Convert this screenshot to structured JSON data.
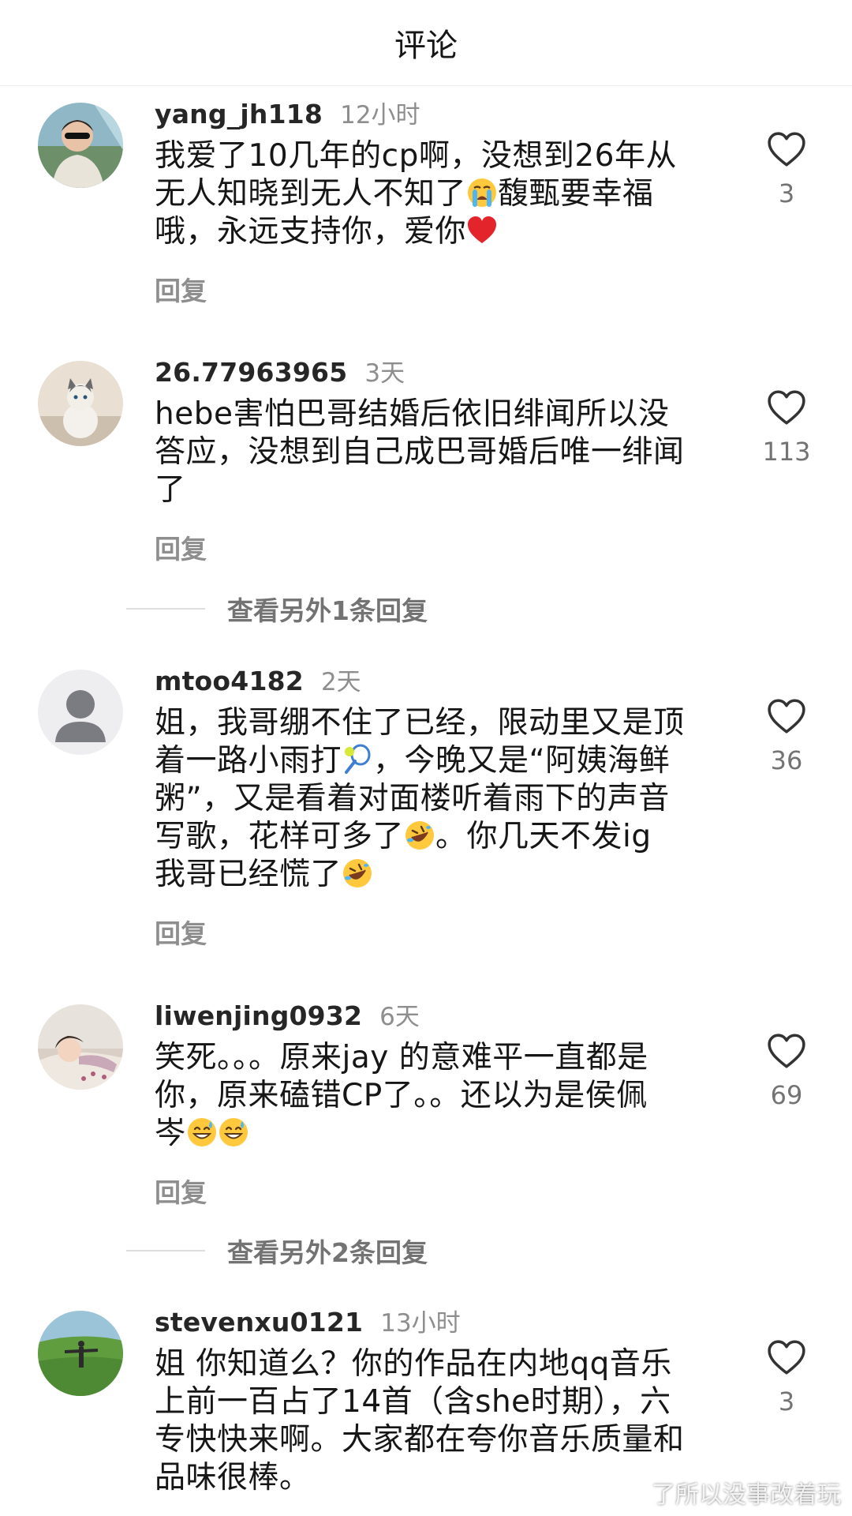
{
  "header": {
    "title": "评论"
  },
  "comments": [
    {
      "username": "yang_jh118",
      "time": "12小时",
      "text_parts": [
        "我爱了10几年的cp啊，没想到26年从\n无人知晓到无人不知了",
        "馥甄要幸福\n哦，永远支持你，爱你",
        ""
      ],
      "reply_label": "回复",
      "likes": "3"
    },
    {
      "username": "26.77963965",
      "time": "3天",
      "text_parts": [
        "hebe害怕巴哥结婚后依旧绯闻所以没\n答应，没想到自己成巴哥婚后唯一绯闻\n了"
      ],
      "reply_label": "回复",
      "likes": "113",
      "more_replies": "查看另外1条回复"
    },
    {
      "username": "mtoo4182",
      "time": "2天",
      "text_parts": [
        "姐，我哥绷不住了已经，限动里又是顶\n着一路小雨打",
        "，今晚又是“阿姨海鲜\n粥”，又是看着对面楼听着雨下的声音\n写歌，花样可多了",
        "。你几天不发ig\n我哥已经慌了",
        ""
      ],
      "reply_label": "回复",
      "likes": "36"
    },
    {
      "username": "liwenjing0932",
      "time": "6天",
      "text_parts": [
        "笑死。。。原来jay 的意难平一直都是\n你，原来磕错CP了。。还以为是侯佩\n岑",
        "",
        ""
      ],
      "reply_label": "回复",
      "likes": "69",
      "more_replies": "查看另外2条回复"
    },
    {
      "username": "stevenxu0121",
      "time": "13小时",
      "text_parts": [
        "姐  你知道么？你的作品在内地qq音乐\n上前一百占了14首（含she时期），六\n专快快来啊。大家都在夸你音乐质量和\n品味很棒。"
      ],
      "likes": "3"
    }
  ],
  "watermark": "了所以没事改着玩",
  "icons": {
    "like": "heart-outline-icon",
    "emoji_cry": "loudly-crying-face-emoji",
    "emoji_heart": "red-heart-emoji",
    "emoji_tennis": "tennis-emoji",
    "emoji_rofl": "rolling-on-floor-laughing-emoji",
    "emoji_sweat": "grinning-face-with-sweat-emoji"
  }
}
